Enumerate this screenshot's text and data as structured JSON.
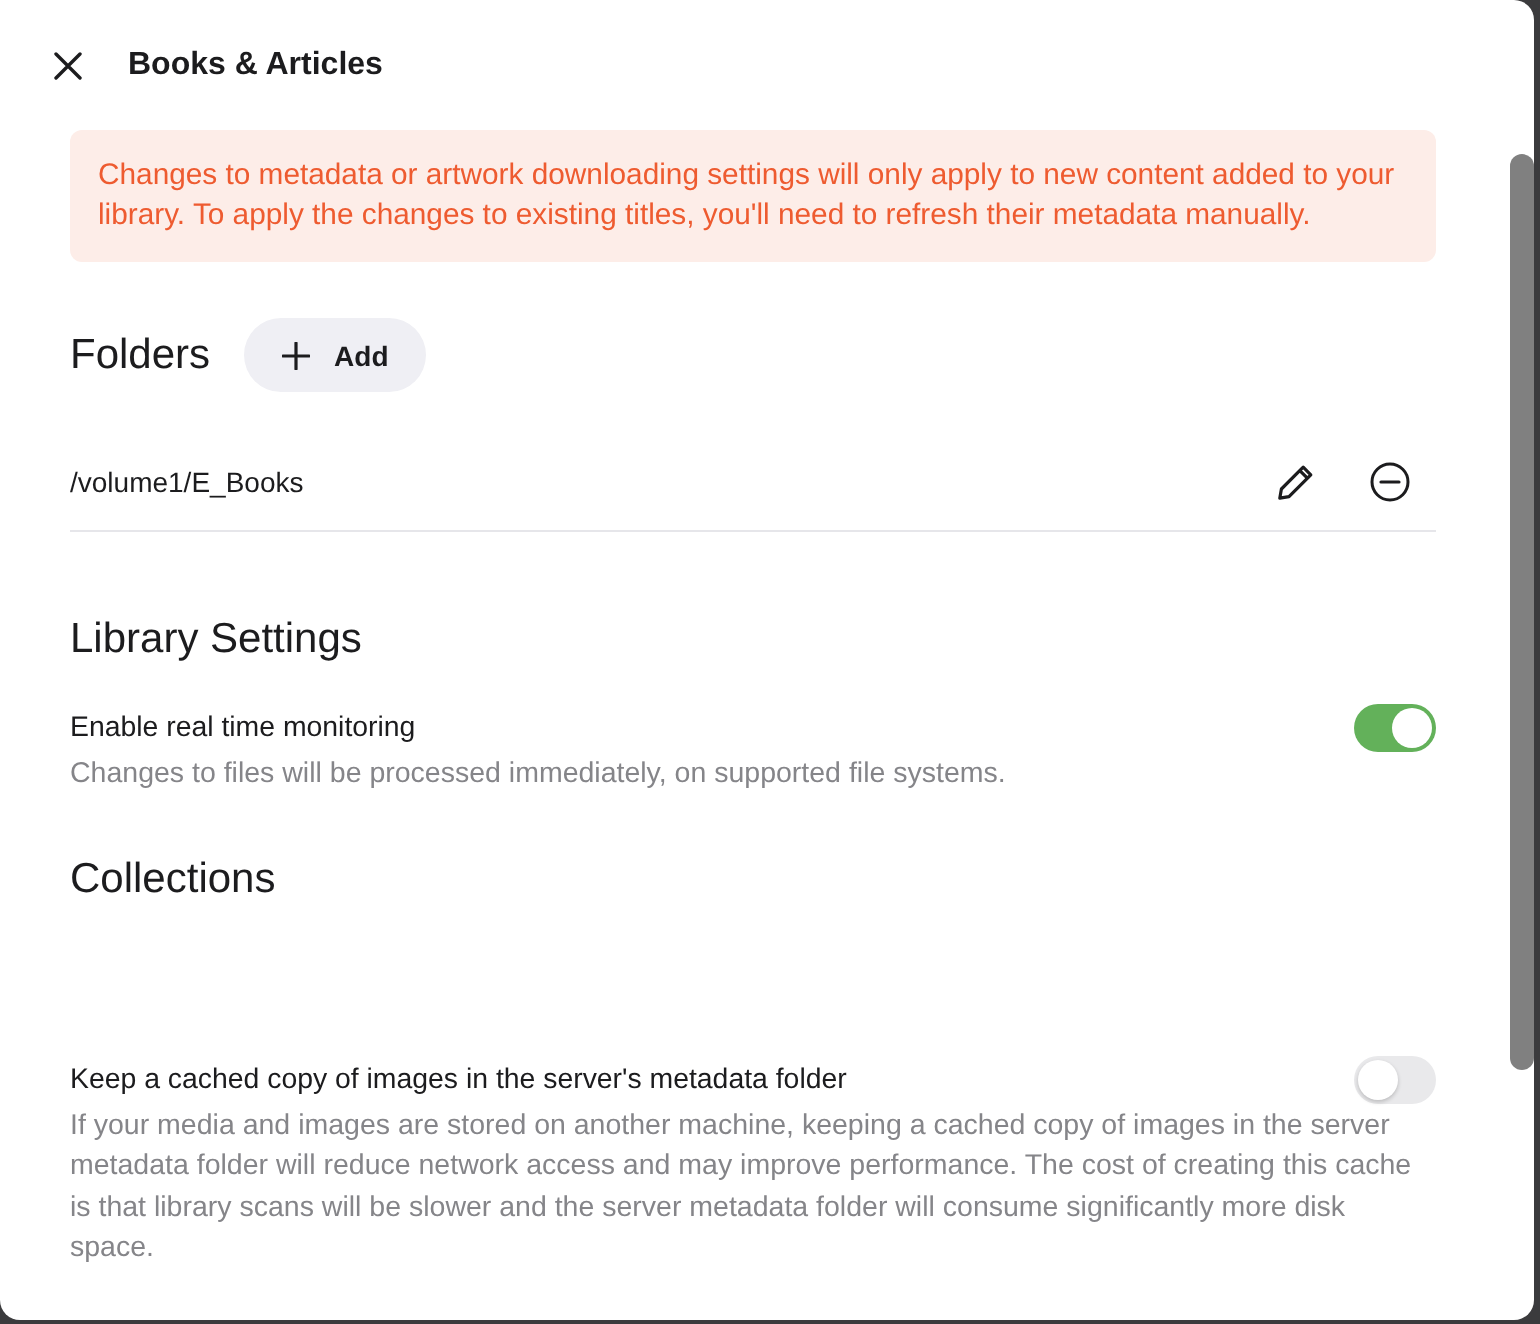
{
  "dialog": {
    "title": "Books & Articles"
  },
  "notice": "Changes to metadata or artwork downloading settings will only apply to new content added to your library. To apply the changes to existing titles, you'll need to refresh their metadata manually.",
  "folders": {
    "heading": "Folders",
    "add_button": "Add",
    "items": [
      {
        "path": "/volume1/E_Books"
      }
    ]
  },
  "library_settings": {
    "heading": "Library Settings",
    "settings": [
      {
        "label": "Enable real time monitoring",
        "description": "Changes to files will be processed immediately, on supported file systems.",
        "on": true
      }
    ]
  },
  "collections": {
    "heading": "Collections",
    "settings": [
      {
        "label": "Keep a cached copy of images in the server's metadata folder",
        "description": "If your media and images are stored on another machine, keeping a cached copy of images in the server metadata folder will reduce network access and may improve performance. The cost of creating this cache is that library scans will be slower and the server metadata folder will consume significantly more disk space.",
        "on": false
      }
    ]
  }
}
